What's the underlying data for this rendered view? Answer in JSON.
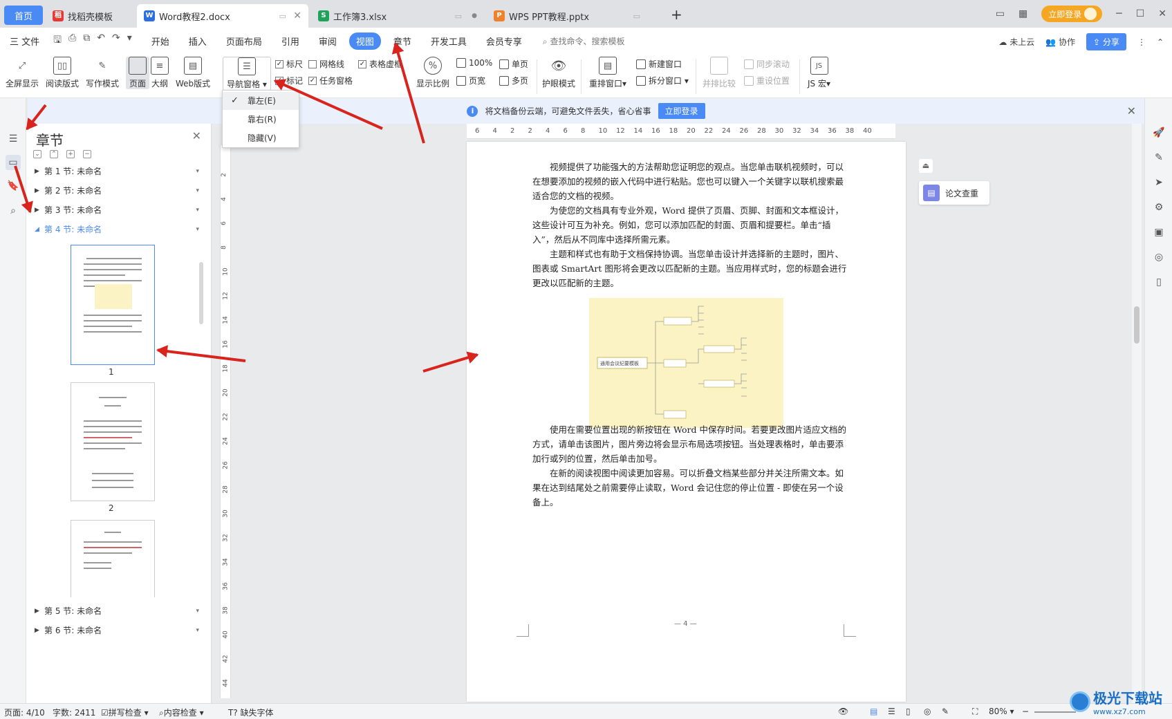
{
  "tabs": {
    "home": "首页",
    "t1": "找稻壳模板",
    "t2": "Word教程2.docx",
    "t3": "工作簿3.xlsx",
    "t4": "WPS PPT教程.pptx",
    "add": "+",
    "login": "立即登录"
  },
  "menubar": {
    "file": "三 文件",
    "items": [
      "开始",
      "插入",
      "页面布局",
      "引用",
      "审阅",
      "视图",
      "章节",
      "开发工具",
      "会员专享"
    ],
    "search": "查找命令、搜索模板",
    "cloud": "未上云",
    "collab": "协作",
    "share": "分享"
  },
  "ribbon": {
    "fullscreen": "全屏显示",
    "read": "阅读版式",
    "write": "写作模式",
    "page": "页面",
    "outline": "大纲",
    "web": "Web版式",
    "nav": "导航窗格",
    "ruler": "标尺",
    "grid": "网格线",
    "tablegrid": "表格虚框",
    "mark": "标记",
    "taskpane": "任务窗格",
    "zoom": "显示比例",
    "zoom100": "100%",
    "single": "单页",
    "pagewidth": "页宽",
    "multi": "多页",
    "eyecare": "护眼模式",
    "rearrange": "重排窗口",
    "newwin": "新建窗口",
    "split": "拆分窗口",
    "sidebyside": "并排比较",
    "syncscroll": "同步滚动",
    "resetpos": "重设位置",
    "jsmacro": "JS 宏"
  },
  "dropdown": {
    "left": "靠左(E)",
    "right": "靠右(R)",
    "hide": "隐藏(V)"
  },
  "notice": {
    "text": "将文档备份云端，可避免文件丢失，省心省事",
    "button": "立即登录"
  },
  "nav": {
    "title": "章节",
    "sections": [
      "第 1 节: 未命名",
      "第 2 节: 未命名",
      "第 3 节: 未命名",
      "第 4 节: 未命名",
      "第 5 节: 未命名",
      "第 6 节: 未命名"
    ],
    "pages": [
      "1",
      "2"
    ]
  },
  "ruler": {
    "h": [
      "6",
      "4",
      "2",
      "2",
      "4",
      "6",
      "8",
      "10",
      "12",
      "14",
      "16",
      "18",
      "20",
      "22",
      "24",
      "26",
      "28",
      "30",
      "32",
      "34",
      "36",
      "38",
      "40"
    ],
    "v": [
      "2",
      "4",
      "6",
      "8",
      "10",
      "12",
      "14",
      "16",
      "18",
      "20",
      "22",
      "24",
      "26",
      "28",
      "30",
      "32",
      "34",
      "36",
      "38",
      "40",
      "42",
      "44"
    ]
  },
  "doc": {
    "p1": "视频提供了功能强大的方法帮助您证明您的观点。当您单击联机视频时，可以在想要添加的视频的嵌入代码中进行粘贴。您也可以键入一个关键字以联机搜索最适合您的文档的视频。",
    "p2": "为使您的文档具有专业外观，Word 提供了页眉、页脚、封面和文本框设计，这些设计可互为补充。例如，您可以添加匹配的封面、页眉和提要栏。单击“插入”，然后从不同库中选择所需元素。",
    "p3": "主题和样式也有助于文档保持协调。当您单击设计并选择新的主题时，图片、图表或 SmartArt 图形将会更改以匹配新的主题。当应用样式时，您的标题会进行更改以匹配新的主题。",
    "p4": "使用在需要位置出现的新按钮在 Word 中保存时间。若要更改图片适应文档的方式，请单击该图片，图片旁边将会显示布局选项按钮。当处理表格时，单击要添加行或列的位置，然后单击加号。",
    "p5": "在新的阅读视图中阅读更加容易。可以折叠文档某些部分并关注所需文本。如果在达到结尾处之前需要停止读取，Word 会记住您的停止位置 - 即使在另一个设备上。",
    "mindmap_center": "通用会议纪要模板",
    "pagenum": "— 4 —"
  },
  "rightpanel": {
    "label": "论文查重"
  },
  "status": {
    "page": "页面: 4/10",
    "words": "字数: 2411",
    "spell": "拼写检查",
    "content": "内容检查",
    "font": "缺失字体",
    "zoom": "80%"
  },
  "watermark": {
    "brand": "极光下载站",
    "url": "www.xz7.com"
  },
  "colors": {
    "accent": "#4a8af4",
    "arrow": "#d8241c"
  }
}
